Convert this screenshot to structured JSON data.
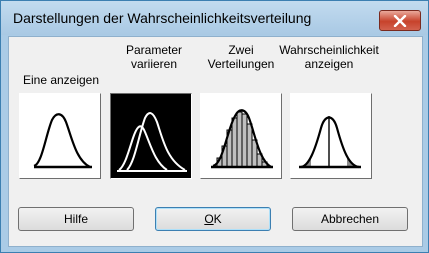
{
  "window": {
    "title": "Darstellungen der Wahrscheinlichkeitsverteilung",
    "close_glyph": "✕"
  },
  "options": [
    {
      "label": "Eine anzeigen",
      "icon": "single-distribution-curve-icon"
    },
    {
      "label_line1": "Parameter",
      "label_line2": "variieren",
      "icon": "varying-parameters-curves-icon",
      "selected": true
    },
    {
      "label_line1": "Zwei",
      "label_line2": "Verteilungen",
      "icon": "two-distributions-histogram-icon"
    },
    {
      "label_line1": "Wahrscheinlichkeit",
      "label_line2": "anzeigen",
      "icon": "shaded-probability-curve-icon"
    }
  ],
  "buttons": {
    "help": "Hilfe",
    "ok_underlined": "O",
    "ok_rest": "K",
    "cancel": "Abbrechen"
  }
}
